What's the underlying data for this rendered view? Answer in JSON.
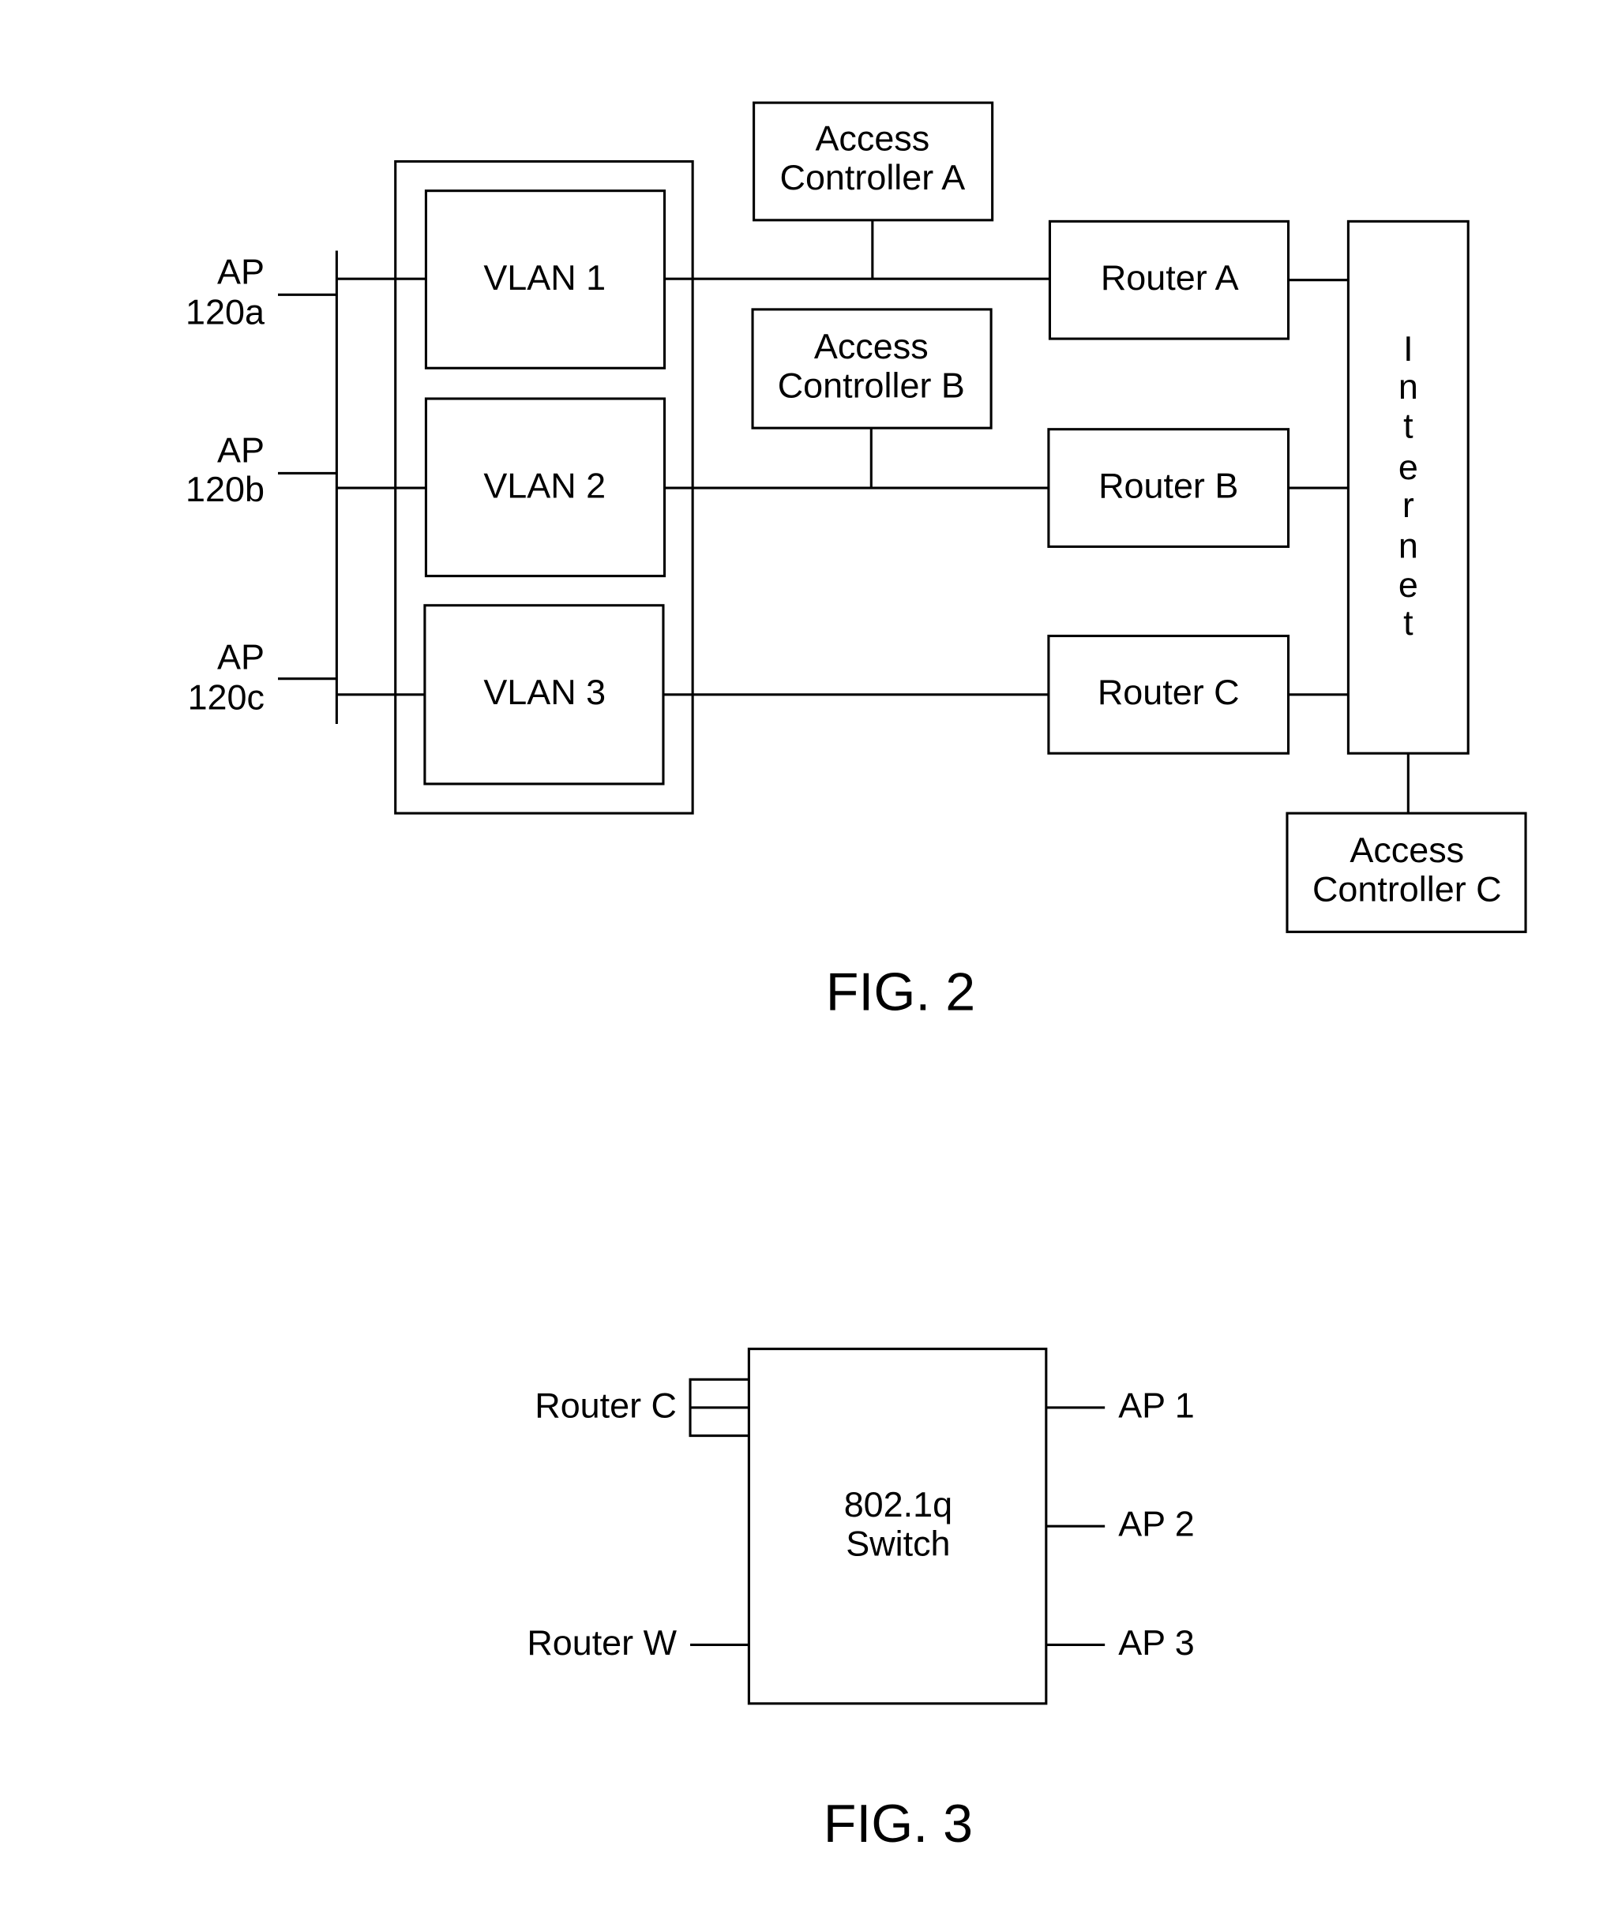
{
  "fig2": {
    "caption": "FIG. 2",
    "aps": [
      {
        "line1": "AP",
        "line2": "120a"
      },
      {
        "line1": "AP",
        "line2": "120b"
      },
      {
        "line1": "AP",
        "line2": "120c"
      }
    ],
    "vlans": [
      "VLAN 1",
      "VLAN 2",
      "VLAN 3"
    ],
    "controllers": [
      {
        "line1": "Access",
        "line2": "Controller A"
      },
      {
        "line1": "Access",
        "line2": "Controller B"
      },
      {
        "line1": "Access",
        "line2": "Controller C"
      }
    ],
    "routers": [
      "Router A",
      "Router B",
      "Router C"
    ],
    "internet_letters": [
      "I",
      "n",
      "t",
      "e",
      "r",
      "n",
      "e",
      "t"
    ]
  },
  "fig3": {
    "caption": "FIG. 3",
    "switch": {
      "line1": "802.1q",
      "line2": "Switch"
    },
    "left_ports": [
      "Router C",
      "Router W"
    ],
    "right_ports": [
      "AP 1",
      "AP 2",
      "AP 3"
    ]
  }
}
